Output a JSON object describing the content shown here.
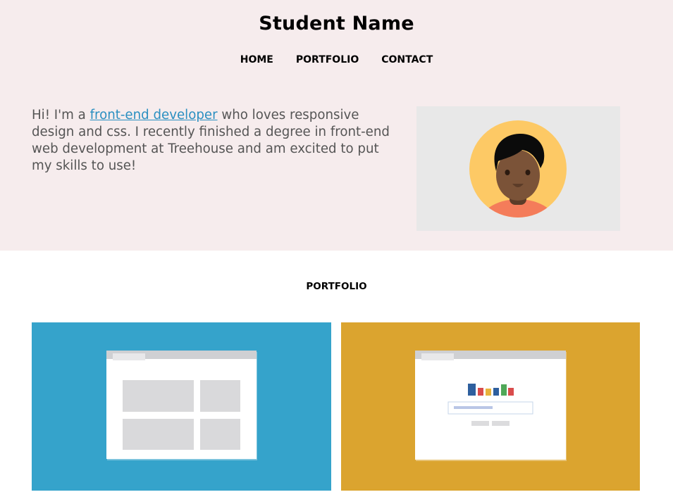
{
  "header": {
    "title": "Student Name",
    "nav": [
      "HOME",
      "PORTFOLIO",
      "CONTACT"
    ]
  },
  "intro": {
    "before": "Hi! I'm a ",
    "link": "front-end developer",
    "after": " who loves responsive design and css. I recently finished a degree in front-end web development at Treehouse and am excited to put my skills to use!"
  },
  "portfolio": {
    "heading": "PORTFOLIO"
  },
  "colors": {
    "hero_bg": "#f6eced",
    "link": "#2a8fc1",
    "card_blue": "#35a3cb",
    "card_gold": "#dba42f"
  },
  "icons": [
    "avatar-illustration",
    "layout-grid-illustration",
    "search-chart-illustration"
  ]
}
